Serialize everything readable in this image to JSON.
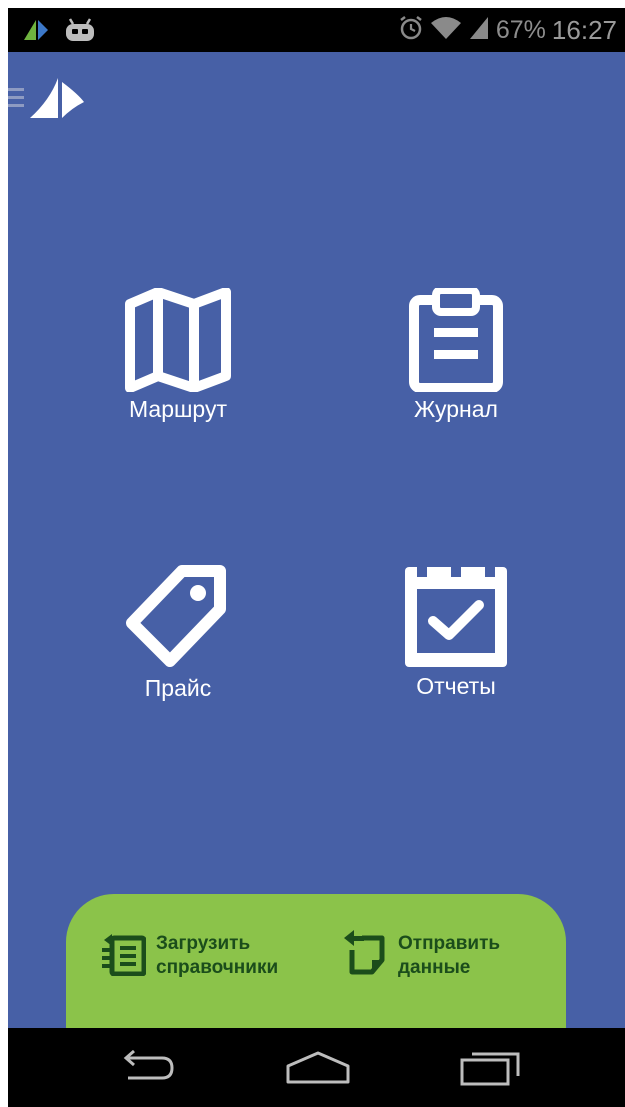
{
  "status_bar": {
    "battery": "67%",
    "time": "16:27",
    "icons": [
      "app-logo-icon",
      "cyanogen-mascot-icon",
      "alarm-icon",
      "wifi-icon",
      "signal-icon"
    ]
  },
  "app_bar": {
    "icons": [
      "menu-icon",
      "sail-logo-icon"
    ]
  },
  "tiles": [
    {
      "label": "Маршрут",
      "icon": "map-icon"
    },
    {
      "label": "Журнал",
      "icon": "clipboard-icon"
    },
    {
      "label": "Прайс",
      "icon": "price-tag-icon"
    },
    {
      "label": "Отчеты",
      "icon": "calendar-check-icon"
    }
  ],
  "actions": [
    {
      "label": "Загрузить\nсправочники",
      "icon": "download-list-icon"
    },
    {
      "label": "Отправить\nданные",
      "icon": "send-data-icon"
    }
  ],
  "colors": {
    "background": "#4760a6",
    "panel": "#8bc34a",
    "panel_text": "#1b4d1b"
  },
  "nav_bar": {
    "icons": [
      "back-icon",
      "home-icon",
      "recent-apps-icon"
    ]
  }
}
